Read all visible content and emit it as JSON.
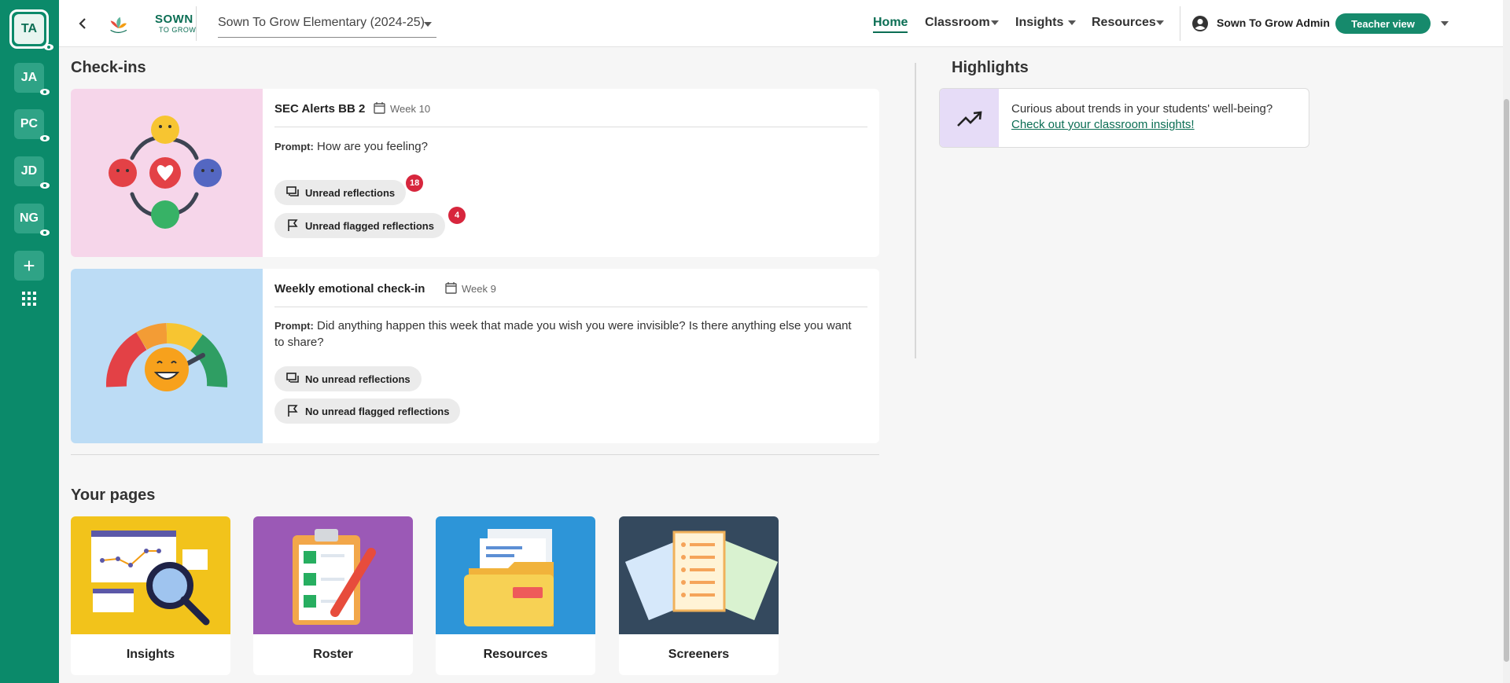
{
  "rail": {
    "items": [
      {
        "initials": "TA"
      },
      {
        "initials": "JA"
      },
      {
        "initials": "PC"
      },
      {
        "initials": "JD"
      },
      {
        "initials": "NG"
      }
    ],
    "add_label": "+"
  },
  "header": {
    "logo_line1": "SOWN",
    "logo_line2": "TO GROW",
    "school": "Sown To Grow Elementary (2024-25)",
    "nav": [
      "Home",
      "Classroom",
      "Insights",
      "Resources"
    ],
    "user_name": "Sown To Grow Admin",
    "view_button": "Teacher view"
  },
  "checkins": {
    "heading": "Check-ins",
    "prompt_label": "Prompt:",
    "cards": [
      {
        "title": "SEC Alerts BB 2",
        "week": "Week 10",
        "prompt": "How are you feeling?",
        "pill1": "Unread reflections",
        "pill1_count": "18",
        "pill2": "Unread flagged reflections",
        "pill2_count": "4"
      },
      {
        "title": "Weekly emotional check-in",
        "week": "Week 9",
        "prompt": "Did anything happen this week that made you wish you were invisible? Is there anything else you want to share?",
        "pill1": "No unread reflections",
        "pill2": "No unread flagged reflections"
      }
    ]
  },
  "highlights": {
    "heading": "Highlights",
    "text": "Curious about trends in your students' well-being?",
    "link": "Check out your classroom insights!"
  },
  "pages": {
    "heading": "Your pages",
    "tiles": [
      {
        "label": "Insights",
        "color": "#f2c31b"
      },
      {
        "label": "Roster",
        "color": "#9b59b6"
      },
      {
        "label": "Resources",
        "color": "#2d95d8"
      },
      {
        "label": "Screeners",
        "color": "#34495e"
      }
    ]
  },
  "colors": {
    "brand": "#0b8a6a",
    "badge": "#d7263d",
    "link": "#0b6e54"
  }
}
